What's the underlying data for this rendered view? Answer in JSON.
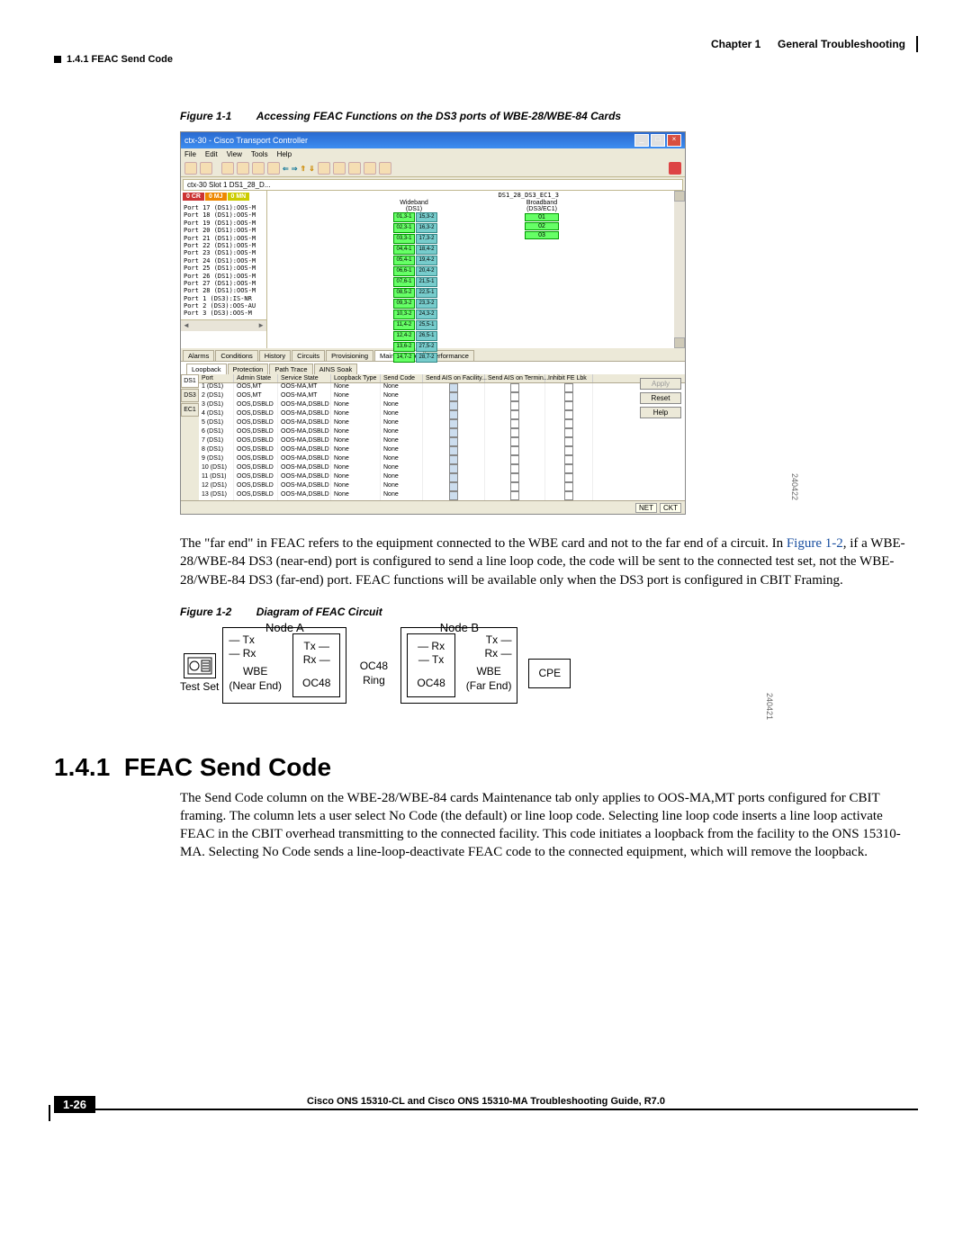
{
  "header": {
    "left": "1.4.1  FEAC Send Code",
    "chapter": "Chapter 1",
    "chapterTitle": "General Troubleshooting"
  },
  "figure1": {
    "num": "Figure 1-1",
    "title": "Accessing FEAC Functions on the DS3 ports of WBE-28/WBE-84 Cards",
    "sidenum": "240422"
  },
  "shot": {
    "title": "ctx-30 - Cisco Transport Controller",
    "menus": [
      "File",
      "Edit",
      "View",
      "Tools",
      "Help"
    ],
    "crumb": "ctx-30 Slot 1 DS1_28_D...",
    "badges": {
      "cr": "0 CR",
      "mj": "0 MJ",
      "mn": "0 MN"
    },
    "ports": [
      "Port 17 (DS1):OOS-M",
      "Port 18 (DS1):OOS-M",
      "Port 19 (DS1):OOS-M",
      "Port 20 (DS1):OOS-M",
      "Port 21 (DS1):OOS-M",
      "Port 22 (DS1):OOS-M",
      "Port 23 (DS1):OOS-M",
      "Port 24 (DS1):OOS-M",
      "Port 25 (DS1):OOS-M",
      "Port 26 (DS1):OOS-M",
      "Port 27 (DS1):OOS-M",
      "Port 28 (DS1):OOS-M",
      "Port 1 (DS3):IS-NR",
      "Port 2 (DS3):OOS-AU",
      "Port 3 (DS3):OOS-M"
    ],
    "slotlabel": "DS1_28_DS3_EC1_3",
    "wbHead": "Wideband (DS1)",
    "bbHead": "Broadband (DS3/EC1)",
    "bbcells": [
      "01",
      "02",
      "03"
    ],
    "pairs": [
      [
        "01,3-1",
        "15,3-2"
      ],
      [
        "02,3-1",
        "16,3-2"
      ],
      [
        "03,3-1",
        "17,3-2"
      ],
      [
        "04,4-1",
        "18,4-2"
      ],
      [
        "05,4-1",
        "19,4-2"
      ],
      [
        "06,6-1",
        "20,4-2"
      ],
      [
        "07,6-1",
        "21,5-1"
      ],
      [
        "08,5-2",
        "22,5-1"
      ],
      [
        "09,3-2",
        "23,3-2"
      ],
      [
        "10,3-2",
        "24,3-2"
      ],
      [
        "11,4-2",
        "25,5-1"
      ],
      [
        "12,4-2",
        "26,5-1"
      ],
      [
        "13,6-2",
        "27,5-2"
      ],
      [
        "14,7-2",
        "28,7-2"
      ]
    ],
    "tabs": [
      "Alarms",
      "Conditions",
      "History",
      "Circuits",
      "Provisioning",
      "Maintenance",
      "Performance"
    ],
    "tabSel": "Maintenance",
    "subtabs": [
      "Loopback",
      "Protection",
      "Path Trace",
      "AINS Soak"
    ],
    "subtabSel": "Loopback",
    "vtabs": [
      "DS1",
      "DS3",
      "EC1"
    ],
    "vtabSel": "DS1",
    "gridHeaders": [
      "Port",
      "Admin State",
      "Service State",
      "Loopback Type",
      "Send Code",
      "Send AIS on Facility...",
      "Send AIS on Termin...",
      "Inhibit FE Lbk"
    ],
    "gridRows": [
      {
        "port": "1 (DS1)",
        "as": "OOS,MT",
        "ss": "OOS-MA,MT",
        "lt": "None",
        "sc": "None"
      },
      {
        "port": "2 (DS1)",
        "as": "OOS,MT",
        "ss": "OOS-MA,MT",
        "lt": "None",
        "sc": "None"
      },
      {
        "port": "3 (DS1)",
        "as": "OOS,DSBLD",
        "ss": "OOS-MA,DSBLD",
        "lt": "None",
        "sc": "None"
      },
      {
        "port": "4 (DS1)",
        "as": "OOS,DSBLD",
        "ss": "OOS-MA,DSBLD",
        "lt": "None",
        "sc": "None"
      },
      {
        "port": "5 (DS1)",
        "as": "OOS,DSBLD",
        "ss": "OOS-MA,DSBLD",
        "lt": "None",
        "sc": "None"
      },
      {
        "port": "6 (DS1)",
        "as": "OOS,DSBLD",
        "ss": "OOS-MA,DSBLD",
        "lt": "None",
        "sc": "None"
      },
      {
        "port": "7 (DS1)",
        "as": "OOS,DSBLD",
        "ss": "OOS-MA,DSBLD",
        "lt": "None",
        "sc": "None"
      },
      {
        "port": "8 (DS1)",
        "as": "OOS,DSBLD",
        "ss": "OOS-MA,DSBLD",
        "lt": "None",
        "sc": "None"
      },
      {
        "port": "9 (DS1)",
        "as": "OOS,DSBLD",
        "ss": "OOS-MA,DSBLD",
        "lt": "None",
        "sc": "None"
      },
      {
        "port": "10 (DS1)",
        "as": "OOS,DSBLD",
        "ss": "OOS-MA,DSBLD",
        "lt": "None",
        "sc": "None"
      },
      {
        "port": "11 (DS1)",
        "as": "OOS,DSBLD",
        "ss": "OOS-MA,DSBLD",
        "lt": "None",
        "sc": "None"
      },
      {
        "port": "12 (DS1)",
        "as": "OOS,DSBLD",
        "ss": "OOS-MA,DSBLD",
        "lt": "None",
        "sc": "None"
      },
      {
        "port": "13 (DS1)",
        "as": "OOS,DSBLD",
        "ss": "OOS-MA,DSBLD",
        "lt": "None",
        "sc": "None"
      }
    ],
    "buttons": {
      "apply": "Apply",
      "reset": "Reset",
      "help": "Help"
    },
    "status": {
      "net": "NET",
      "ckt": "CKT"
    }
  },
  "para1_a": "The \"far end\" in FEAC refers to the equipment connected to the WBE card and not to the far end of a circuit. In ",
  "para1_link": "Figure 1-2",
  "para1_b": ", if a WBE-28/WBE-84 DS3 (near-end) port is configured to send a line loop code, the code will be sent to the connected test set, not the WBE-28/WBE-84 DS3 (far-end) port. FEAC functions will be available only when the DS3 port is configured in CBIT Framing.",
  "figure2": {
    "num": "Figure 1-2",
    "title": "Diagram of FEAC Circuit",
    "sidenum": "240421",
    "labels": {
      "nodeA": "Node A",
      "nodeB": "Node B",
      "tx": "Tx",
      "rx": "Rx",
      "testset": "Test Set",
      "wbe": "WBE",
      "near": "(Near End)",
      "far": "(Far End)",
      "oc48": "OC48",
      "ring": "Ring",
      "cpe": "CPE"
    }
  },
  "section": {
    "num": "1.4.1",
    "title": "FEAC Send Code",
    "body": "The Send Code column on the WBE-28/WBE-84 cards Maintenance tab only applies to OOS-MA,MT ports configured for CBIT framing. The column lets a user select No Code (the default) or line loop code. Selecting line loop code inserts a line loop activate FEAC in the CBIT overhead transmitting to the connected facility. This code initiates a loopback from the facility to the ONS 15310-MA. Selecting No Code sends a line-loop-deactivate FEAC code to the connected equipment, which will remove the loopback."
  },
  "footer": {
    "title": "Cisco ONS 15310-CL and Cisco ONS 15310-MA Troubleshooting Guide, R7.0",
    "page": "1-26"
  }
}
